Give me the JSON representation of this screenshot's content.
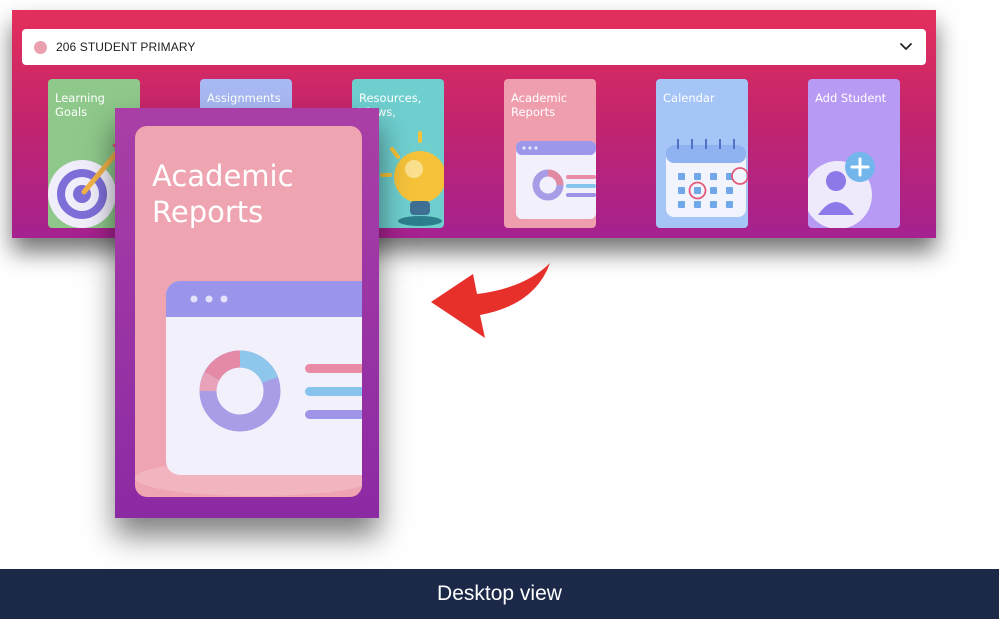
{
  "student_select": {
    "name": "206 STUDENT PRIMARY",
    "dot_color": "#eba0b0"
  },
  "tiles": [
    {
      "label": "Learning Goals",
      "icon": "target-icon",
      "color": "#8ec88a"
    },
    {
      "label": "Assignments",
      "icon": "clipboard-icon",
      "color": "#a7b8f2"
    },
    {
      "label": "Resources, Views,",
      "icon": "lightbulb-icon",
      "color": "#6fcfcf"
    },
    {
      "label": "Academic Reports",
      "icon": "report-chart-icon",
      "color": "#ef9eae"
    },
    {
      "label": "Calendar",
      "icon": "calendar-icon",
      "color": "#a6c5f7"
    },
    {
      "label": "Add Student",
      "icon": "add-user-icon",
      "color": "#b79af3"
    }
  ],
  "zoom_card": {
    "title": "Academic Reports",
    "icon": "report-chart-icon"
  },
  "arrow": {
    "icon": "curved-arrow-icon",
    "color": "#e8302a"
  },
  "footer": {
    "caption": "Desktop view"
  }
}
